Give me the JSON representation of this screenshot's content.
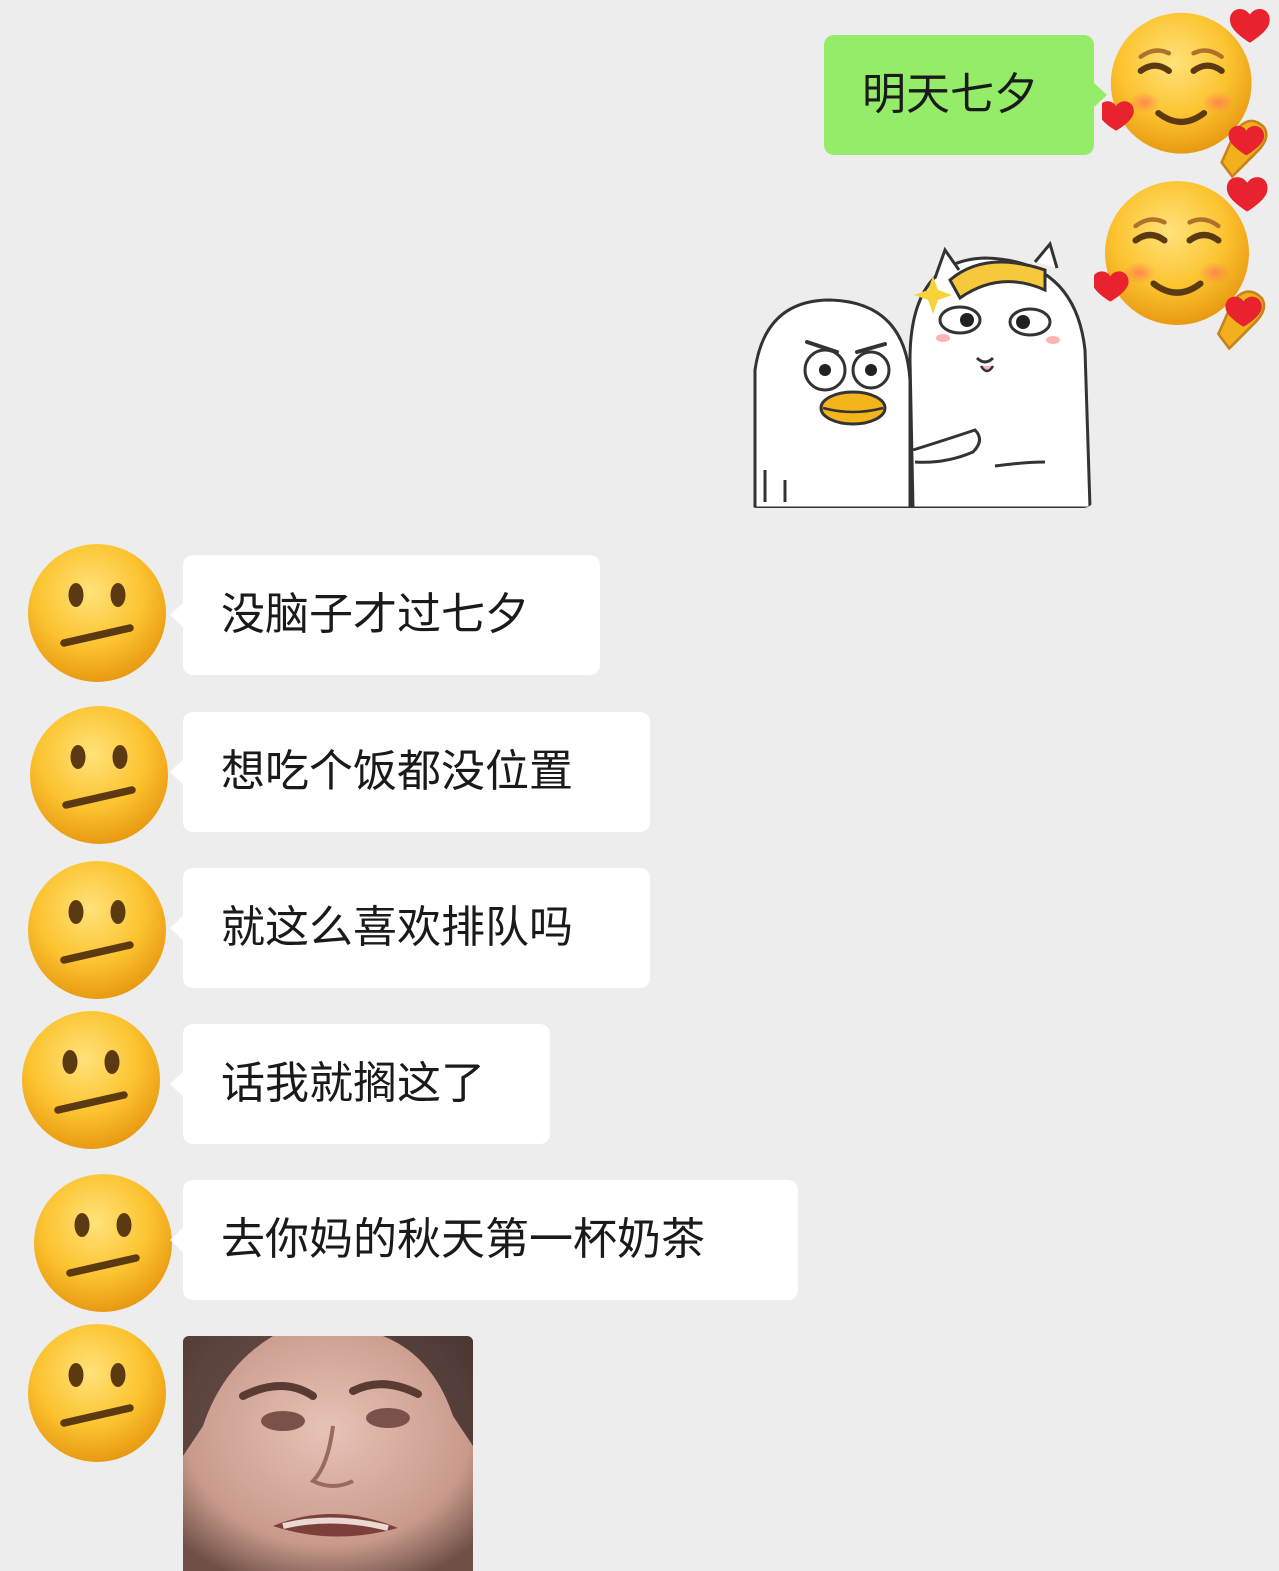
{
  "messages": [
    {
      "side": "out",
      "type": "text",
      "text": "明天七夕",
      "avatar": "smiling-hearts-emoji"
    },
    {
      "side": "out",
      "type": "sticker",
      "sticker": "duck-and-cat-hug-sticker",
      "avatar": "smiling-hearts-emoji"
    },
    {
      "side": "in",
      "type": "text",
      "text": "没脑子才过七夕",
      "avatar": "neutral-face-emoji"
    },
    {
      "side": "in",
      "type": "text",
      "text": "想吃个饭都没位置",
      "avatar": "neutral-face-emoji"
    },
    {
      "side": "in",
      "type": "text",
      "text": "就这么喜欢排队吗",
      "avatar": "neutral-face-emoji"
    },
    {
      "side": "in",
      "type": "text",
      "text": "话我就搁这了",
      "avatar": "neutral-face-emoji"
    },
    {
      "side": "in",
      "type": "text",
      "text": "去你妈的秋天第一杯奶茶",
      "avatar": "neutral-face-emoji"
    },
    {
      "side": "in",
      "type": "sticker",
      "sticker": "grimacing-face-photo",
      "avatar": "neutral-face-emoji"
    }
  ],
  "colors": {
    "background": "#ededed",
    "outgoing_bubble": "#95ec69",
    "incoming_bubble": "#ffffff",
    "text": "#1a1a1a"
  }
}
